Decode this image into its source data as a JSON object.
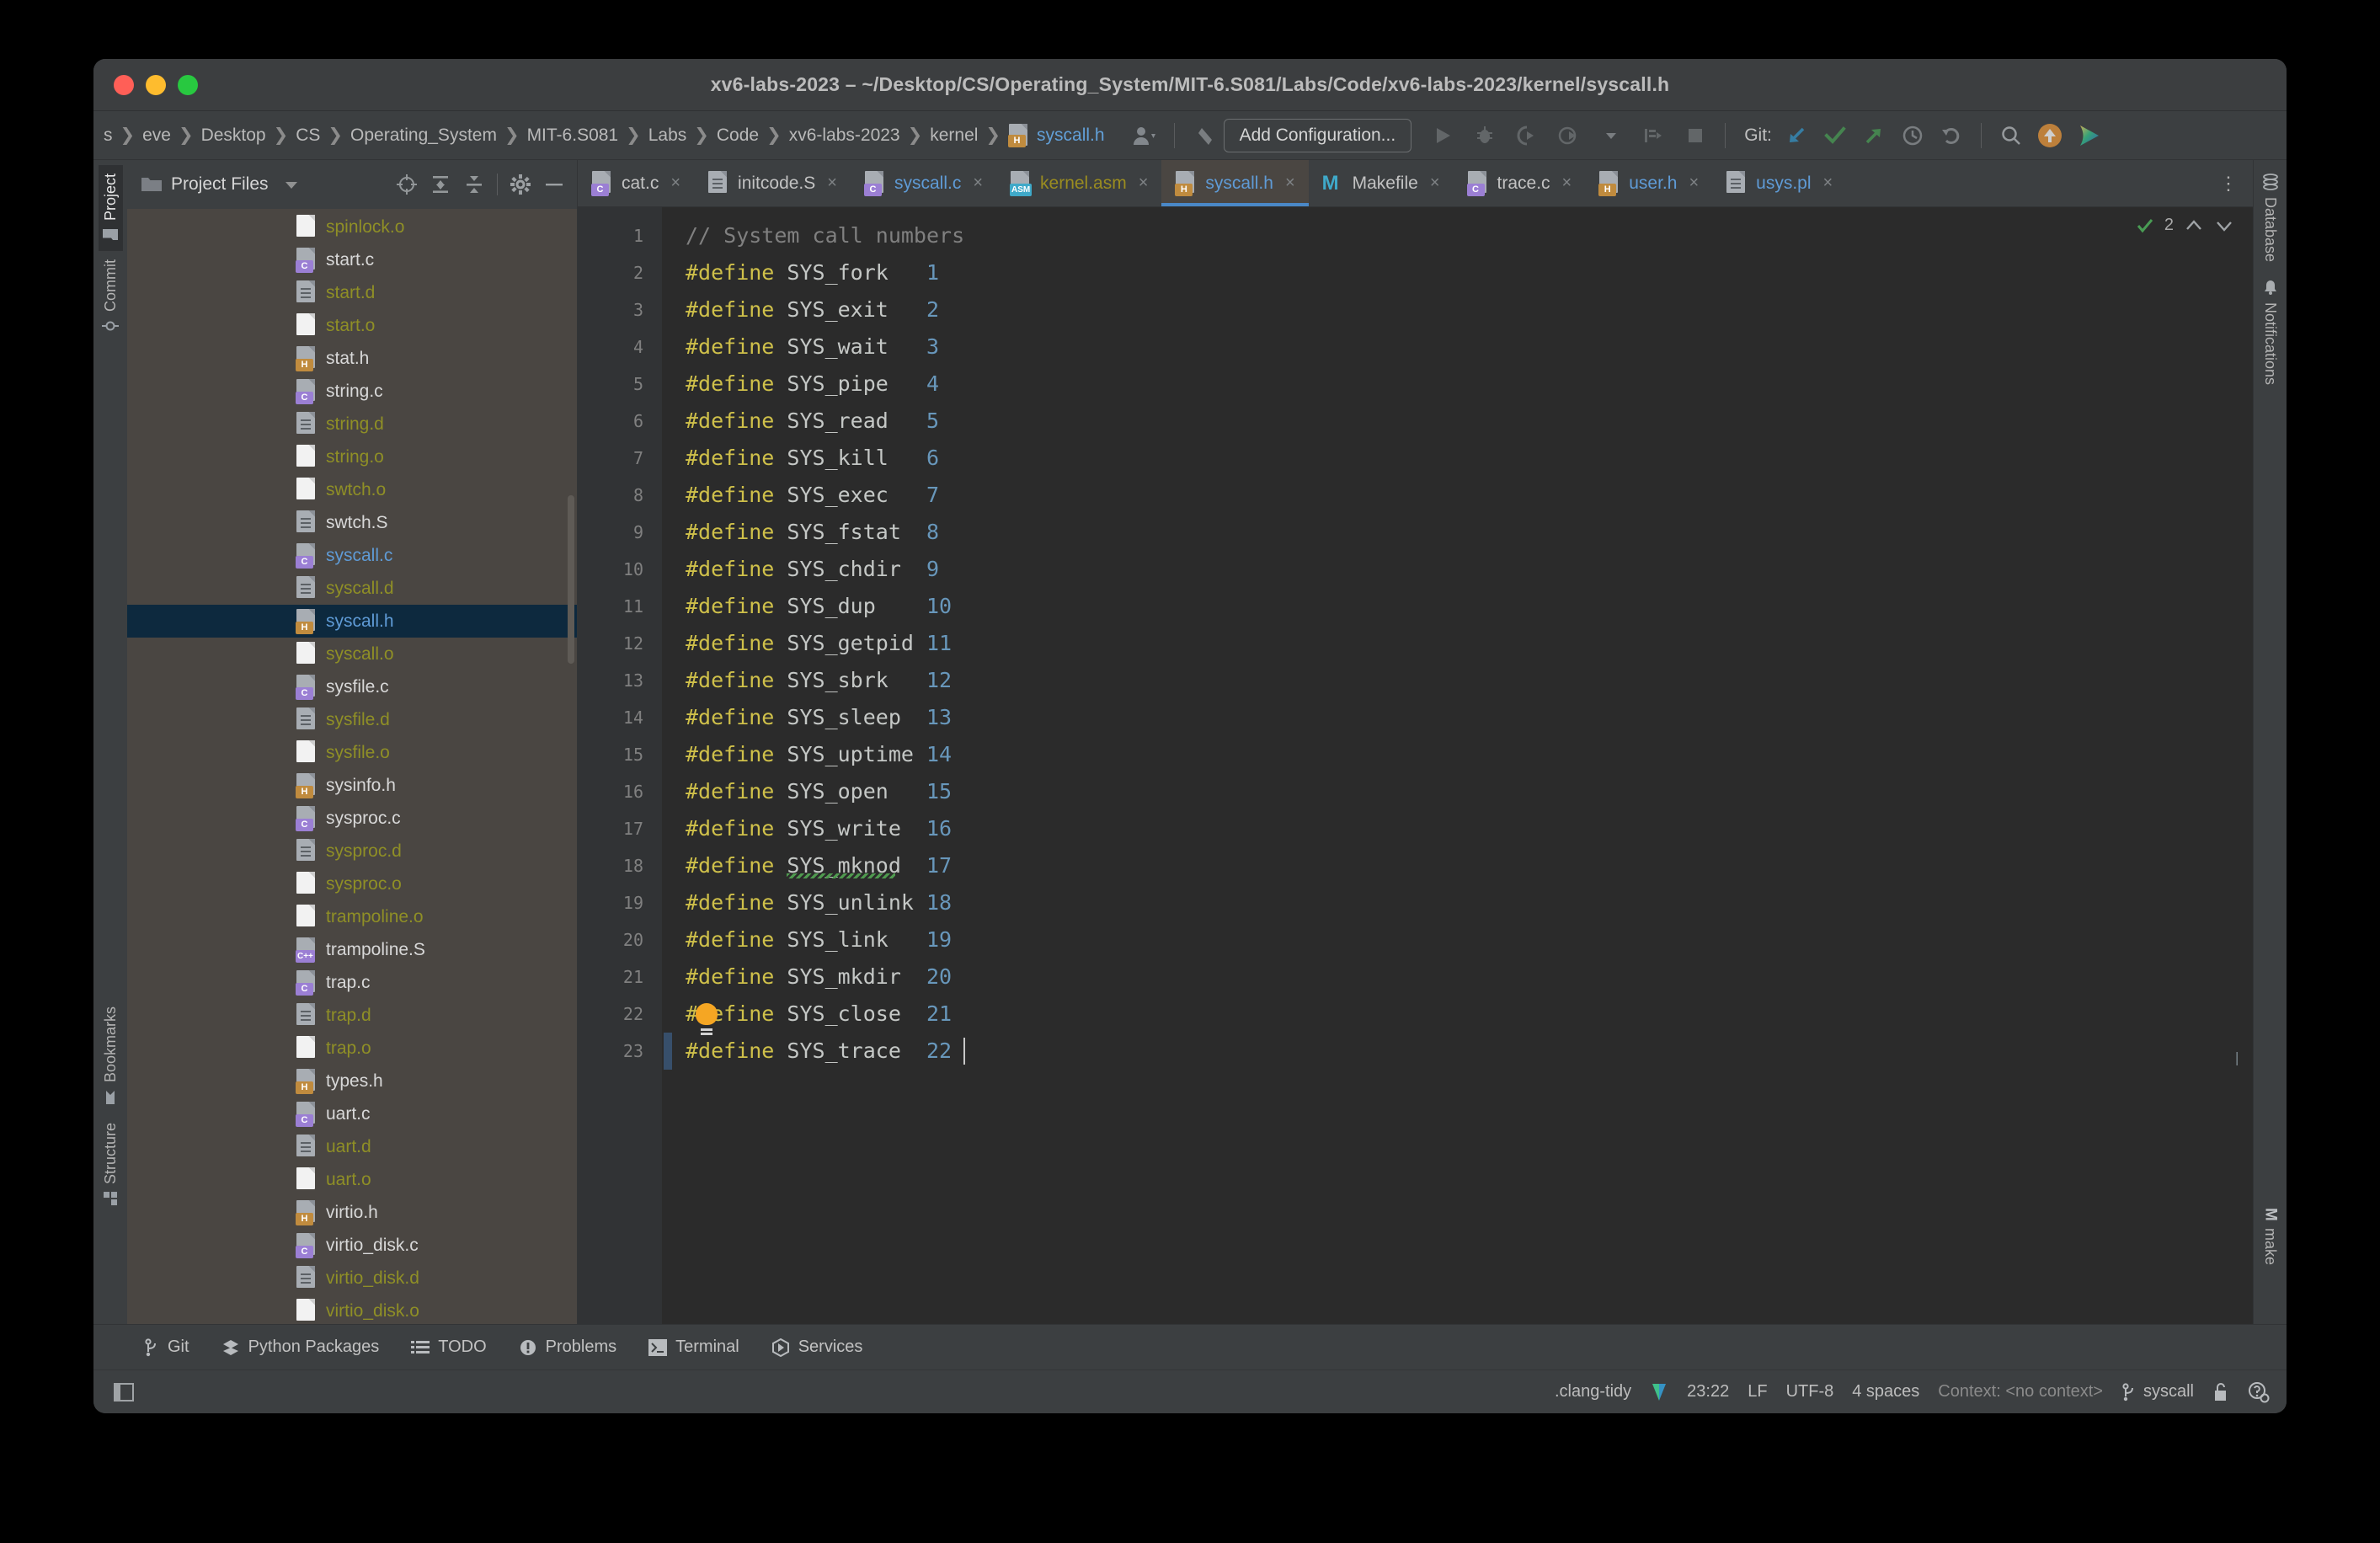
{
  "window": {
    "title": "xv6-labs-2023 – ~/Desktop/CS/Operating_System/MIT-6.S081/Labs/Code/xv6-labs-2023/kernel/syscall.h",
    "traffic_lights": [
      "close",
      "minimize",
      "zoom"
    ]
  },
  "breadcrumb": {
    "items": [
      "s",
      "eve",
      "Desktop",
      "CS",
      "Operating_System",
      "MIT-6.S081",
      "Labs",
      "Code",
      "xv6-labs-2023",
      "kernel"
    ],
    "file": "syscall.h",
    "separator": "❯"
  },
  "toolbar": {
    "add_configuration": "Add Configuration...",
    "git_label": "Git:",
    "icons": [
      "user-avatar-icon",
      "back-arrow-icon",
      "run-icon",
      "debug-icon",
      "run-coverage-icon",
      "profile-icon",
      "dropdown-icon",
      "build-icon",
      "stop-icon",
      "git-update-icon",
      "git-commit-icon",
      "git-push-icon",
      "git-history-icon",
      "git-rollback-icon",
      "search-icon",
      "updates-icon",
      "ai-assistant-icon"
    ]
  },
  "left_strip": {
    "tabs": [
      {
        "label": "Project",
        "icon": "folder-icon",
        "active": true
      },
      {
        "label": "Commit",
        "icon": "commit-icon",
        "active": false
      },
      {
        "label": "Bookmarks",
        "icon": "bookmark-icon",
        "active": false
      },
      {
        "label": "Structure",
        "icon": "structure-icon",
        "active": false
      }
    ]
  },
  "right_strip": {
    "tabs": [
      {
        "label": "Database",
        "icon": "database-icon"
      },
      {
        "label": "Notifications",
        "icon": "bell-icon"
      }
    ],
    "bottom": {
      "label": "make",
      "icon": "make-icon"
    }
  },
  "project_panel": {
    "title": "Project Files",
    "icon": "folder-icon",
    "actions": [
      "locate-icon",
      "expand-all-icon",
      "collapse-all-icon",
      "settings-icon",
      "hide-icon"
    ],
    "files": [
      {
        "name": "spinlock.o",
        "type": "o",
        "state": "ignored"
      },
      {
        "name": "start.c",
        "type": "c",
        "state": "plain"
      },
      {
        "name": "start.d",
        "type": "d",
        "state": "ignored"
      },
      {
        "name": "start.o",
        "type": "o",
        "state": "ignored"
      },
      {
        "name": "stat.h",
        "type": "h",
        "state": "plain"
      },
      {
        "name": "string.c",
        "type": "c",
        "state": "plain"
      },
      {
        "name": "string.d",
        "type": "d",
        "state": "ignored"
      },
      {
        "name": "string.o",
        "type": "o",
        "state": "ignored"
      },
      {
        "name": "swtch.o",
        "type": "o",
        "state": "ignored"
      },
      {
        "name": "swtch.S",
        "type": "d",
        "state": "plain"
      },
      {
        "name": "syscall.c",
        "type": "c",
        "state": "modified"
      },
      {
        "name": "syscall.d",
        "type": "d",
        "state": "ignored"
      },
      {
        "name": "syscall.h",
        "type": "h",
        "state": "modified",
        "selected": true
      },
      {
        "name": "syscall.o",
        "type": "o",
        "state": "ignored"
      },
      {
        "name": "sysfile.c",
        "type": "c",
        "state": "plain"
      },
      {
        "name": "sysfile.d",
        "type": "d",
        "state": "ignored"
      },
      {
        "name": "sysfile.o",
        "type": "o",
        "state": "ignored"
      },
      {
        "name": "sysinfo.h",
        "type": "h",
        "state": "plain"
      },
      {
        "name": "sysproc.c",
        "type": "c",
        "state": "plain"
      },
      {
        "name": "sysproc.d",
        "type": "d",
        "state": "ignored"
      },
      {
        "name": "sysproc.o",
        "type": "o",
        "state": "ignored"
      },
      {
        "name": "trampoline.o",
        "type": "o",
        "state": "ignored"
      },
      {
        "name": "trampoline.S",
        "type": "cpp",
        "state": "plain"
      },
      {
        "name": "trap.c",
        "type": "c",
        "state": "plain"
      },
      {
        "name": "trap.d",
        "type": "d",
        "state": "ignored"
      },
      {
        "name": "trap.o",
        "type": "o",
        "state": "ignored"
      },
      {
        "name": "types.h",
        "type": "h",
        "state": "plain"
      },
      {
        "name": "uart.c",
        "type": "c",
        "state": "plain"
      },
      {
        "name": "uart.d",
        "type": "d",
        "state": "ignored"
      },
      {
        "name": "uart.o",
        "type": "o",
        "state": "ignored"
      },
      {
        "name": "virtio.h",
        "type": "h",
        "state": "plain"
      },
      {
        "name": "virtio_disk.c",
        "type": "c",
        "state": "plain"
      },
      {
        "name": "virtio_disk.d",
        "type": "d",
        "state": "ignored"
      },
      {
        "name": "virtio_disk.o",
        "type": "o",
        "state": "ignored"
      }
    ]
  },
  "editor_tabs": [
    {
      "label": "cat.c",
      "type": "c",
      "state": "plain",
      "active": false
    },
    {
      "label": "initcode.S",
      "type": "d",
      "state": "plain",
      "active": false
    },
    {
      "label": "syscall.c",
      "type": "c",
      "state": "modified",
      "active": false
    },
    {
      "label": "kernel.asm",
      "type": "asm",
      "state": "asm",
      "active": false
    },
    {
      "label": "syscall.h",
      "type": "h",
      "state": "modified",
      "active": true
    },
    {
      "label": "Makefile",
      "type": "m",
      "state": "plain",
      "active": false
    },
    {
      "label": "trace.c",
      "type": "c",
      "state": "plain",
      "active": false
    },
    {
      "label": "user.h",
      "type": "h",
      "state": "modified",
      "active": false
    },
    {
      "label": "usys.pl",
      "type": "d",
      "state": "modified",
      "active": false
    }
  ],
  "editor": {
    "close_label": "×",
    "more_label": "⋮",
    "inspection_count": "2",
    "lines": [
      {
        "n": "1",
        "kind": "comment",
        "text": "// System call numbers"
      },
      {
        "n": "2",
        "kind": "define",
        "keyword": "#define",
        "name": "SYS_fork",
        "value": "1"
      },
      {
        "n": "3",
        "kind": "define",
        "keyword": "#define",
        "name": "SYS_exit",
        "value": "2"
      },
      {
        "n": "4",
        "kind": "define",
        "keyword": "#define",
        "name": "SYS_wait",
        "value": "3"
      },
      {
        "n": "5",
        "kind": "define",
        "keyword": "#define",
        "name": "SYS_pipe",
        "value": "4"
      },
      {
        "n": "6",
        "kind": "define",
        "keyword": "#define",
        "name": "SYS_read",
        "value": "5"
      },
      {
        "n": "7",
        "kind": "define",
        "keyword": "#define",
        "name": "SYS_kill",
        "value": "6"
      },
      {
        "n": "8",
        "kind": "define",
        "keyword": "#define",
        "name": "SYS_exec",
        "value": "7"
      },
      {
        "n": "9",
        "kind": "define",
        "keyword": "#define",
        "name": "SYS_fstat",
        "value": "8"
      },
      {
        "n": "10",
        "kind": "define",
        "keyword": "#define",
        "name": "SYS_chdir",
        "value": "9"
      },
      {
        "n": "11",
        "kind": "define",
        "keyword": "#define",
        "name": "SYS_dup",
        "value": "10"
      },
      {
        "n": "12",
        "kind": "define",
        "keyword": "#define",
        "name": "SYS_getpid",
        "value": "11"
      },
      {
        "n": "13",
        "kind": "define",
        "keyword": "#define",
        "name": "SYS_sbrk",
        "value": "12"
      },
      {
        "n": "14",
        "kind": "define",
        "keyword": "#define",
        "name": "SYS_sleep",
        "value": "13"
      },
      {
        "n": "15",
        "kind": "define",
        "keyword": "#define",
        "name": "SYS_uptime",
        "value": "14"
      },
      {
        "n": "16",
        "kind": "define",
        "keyword": "#define",
        "name": "SYS_open",
        "value": "15"
      },
      {
        "n": "17",
        "kind": "define",
        "keyword": "#define",
        "name": "SYS_write",
        "value": "16"
      },
      {
        "n": "18",
        "kind": "define",
        "keyword": "#define",
        "name": "SYS_mknod",
        "value": "17",
        "warning": true
      },
      {
        "n": "19",
        "kind": "define",
        "keyword": "#define",
        "name": "SYS_unlink",
        "value": "18"
      },
      {
        "n": "20",
        "kind": "define",
        "keyword": "#define",
        "name": "SYS_link",
        "value": "19"
      },
      {
        "n": "21",
        "kind": "define",
        "keyword": "#define",
        "name": "SYS_mkdir",
        "value": "20"
      },
      {
        "n": "22",
        "kind": "define",
        "keyword": "#define",
        "name": "SYS_close",
        "value": "21",
        "bulb": true
      },
      {
        "n": "23",
        "kind": "define",
        "keyword": "#define",
        "name": "SYS_trace",
        "value": "22",
        "changed": true,
        "caret": true
      }
    ]
  },
  "bottom_bar": {
    "items": [
      {
        "label": "Git",
        "icon": "git-branch-icon"
      },
      {
        "label": "Python Packages",
        "icon": "python-packages-icon"
      },
      {
        "label": "TODO",
        "icon": "todo-list-icon"
      },
      {
        "label": "Problems",
        "icon": "problems-icon"
      },
      {
        "label": "Terminal",
        "icon": "terminal-icon"
      },
      {
        "label": "Services",
        "icon": "services-icon"
      }
    ]
  },
  "status_bar": {
    "clang_tidy": ".clang-tidy",
    "inspection_icon": "inspection-widget-icon",
    "caret_position": "23:22",
    "line_separator": "LF",
    "encoding": "UTF-8",
    "indent": "4 spaces",
    "context": "Context: <no context>",
    "branch": "syscall",
    "branch_icon": "git-branch-icon",
    "lock_icon": "unlocked-icon",
    "help_icon": "help-gear-icon"
  },
  "colors": {
    "accent_blue": "#4a88c7",
    "tab_active_bg": "#4a642",
    "tree_bg": "#4a4642",
    "editor_bg": "#2b2b2b",
    "selection": "#0d293e",
    "keyword": "#cfc04a",
    "number": "#6897bb",
    "ignored_file": "#8f8f26",
    "modified_file": "#5f9bd6"
  }
}
